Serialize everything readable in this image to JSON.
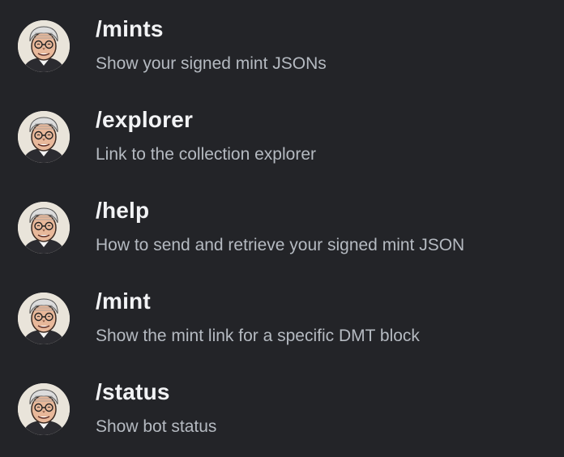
{
  "commands": [
    {
      "name": "/mints",
      "description": "Show your signed mint JSONs",
      "avatar_icon": "old-man-avatar-icon"
    },
    {
      "name": "/explorer",
      "description": "Link to the collection explorer",
      "avatar_icon": "old-man-avatar-icon"
    },
    {
      "name": "/help",
      "description": "How to send and retrieve your signed mint JSON",
      "avatar_icon": "old-man-avatar-icon"
    },
    {
      "name": "/mint",
      "description": "Show the mint link for a specific DMT block",
      "avatar_icon": "old-man-avatar-icon"
    },
    {
      "name": "/status",
      "description": "Show bot status",
      "avatar_icon": "old-man-avatar-icon"
    }
  ],
  "colors": {
    "background": "#232428",
    "command_text": "#f2f3f5",
    "description_text": "#b5bac1"
  }
}
